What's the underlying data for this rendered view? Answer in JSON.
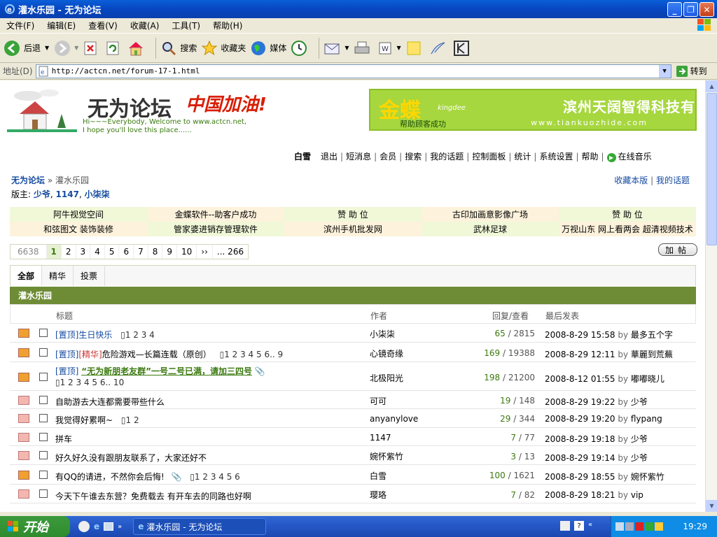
{
  "window": {
    "title": "灌水乐园 - 无为论坛"
  },
  "menu": [
    "文件(F)",
    "编辑(E)",
    "查看(V)",
    "收藏(A)",
    "工具(T)",
    "帮助(H)"
  ],
  "toolbar": {
    "back": "后退",
    "search": "搜索",
    "favorites": "收藏夹",
    "media": "媒体"
  },
  "address": {
    "label": "地址(D)",
    "url": "http://actcn.net/forum-17-1.html",
    "go": "转到"
  },
  "header": {
    "logo_title": "无为论坛",
    "logo_slogan": "中国加油!",
    "logo_greet1": "Hi~~~Everybody, Welcome to www.actcn.net,",
    "logo_greet2": "I hope you'll love this place......",
    "banner_brand": "金蝶",
    "banner_brand_en": "kingdee",
    "banner_slogan": "帮助顾客成功",
    "banner_company": "滨州天阔智得科技有",
    "banner_url": "www.tiankuozhide.com"
  },
  "nav": {
    "user": "白雪",
    "items": [
      "退出",
      "短消息",
      "会员",
      "搜索",
      "我的话题",
      "控制面板",
      "统计",
      "系统设置",
      "帮助"
    ],
    "music": "在线音乐"
  },
  "breadcrumb": {
    "home": "无为论坛",
    "current": "» 灌水乐园"
  },
  "moderators": {
    "label": "版主:",
    "names": [
      "少爷",
      "1147",
      "小柒柒"
    ]
  },
  "right_links": [
    "收藏本版",
    "我的话题"
  ],
  "ads": [
    "阿牛视觉空间",
    "金蝶软件--助客户成功",
    "赞 助 位",
    "古印加画意影像广场",
    "赞 助 位",
    "和弦图文 装饰装修",
    "管家婆进销存管理软件",
    "滨州手机批发网",
    "武林足球",
    "万视山东 网上看两会 超清视频技术"
  ],
  "pager": {
    "total": "6638",
    "pages": [
      "1",
      "2",
      "3",
      "4",
      "5",
      "6",
      "7",
      "8",
      "9",
      "10"
    ],
    "next": "››",
    "last": "... 266"
  },
  "post_button": "加帖",
  "tabs": [
    "全部",
    "精华",
    "投票"
  ],
  "forum_name": "灌水乐园",
  "columns": {
    "title": "标题",
    "author": "作者",
    "stats": "回复/查看",
    "last": "最后发表"
  },
  "threads": [
    {
      "tag": "[置顶]",
      "title": "生日快乐",
      "pages": "1 2 3 4",
      "author": "小柒柒",
      "replies": "65",
      "views": "2815",
      "last_time": "2008-8-29 15:58",
      "last_by": "最多五个字"
    },
    {
      "tag": "[置顶]",
      "tag2": "[精华]",
      "title": "危险游戏—长篇连载（原创）",
      "pages": "1 2 3 4 5 6.. 9",
      "author": "心镜奇缘",
      "replies": "169",
      "views": "19388",
      "last_time": "2008-8-29 12:11",
      "last_by": "華麗到荒蕪"
    },
    {
      "tag": "[置顶]",
      "hot": "“无为新朋老友群”一号二号已满，请加三四号",
      "pages": "1 2 3 4 5 6.. 10",
      "author": "北极阳光",
      "replies": "198",
      "views": "21200",
      "last_time": "2008-8-12 01:55",
      "last_by": "嘟嘟晓儿"
    },
    {
      "title": "自助游去大连都需要带些什么",
      "author": "可可",
      "replies": "19",
      "views": "148",
      "last_time": "2008-8-29 19:22",
      "last_by": "少爷"
    },
    {
      "title": "我觉得好累啊~",
      "pages": "1 2",
      "author": "anyanylove",
      "replies": "29",
      "views": "344",
      "last_time": "2008-8-29 19:20",
      "last_by": "flypang"
    },
    {
      "title": "拼车",
      "author": "1147",
      "replies": "7",
      "views": "77",
      "last_time": "2008-8-29 19:18",
      "last_by": "少爷"
    },
    {
      "title": "好久好久没有跟朋友联系了，大家还好不",
      "author": "婉怀紫竹",
      "replies": "3",
      "views": "13",
      "last_time": "2008-8-29 19:14",
      "last_by": "少爷"
    },
    {
      "title": "有QQ的请进，不然你会后悔!",
      "pages": "1 2 3 4 5 6",
      "author": "白雪",
      "replies": "100",
      "views": "1621",
      "last_time": "2008-8-29 18:55",
      "last_by": "婉怀紫竹"
    },
    {
      "title": "今天下午谁去东营？免费载去 有开车去的同路也好啊",
      "author": "璎珞",
      "replies": "7",
      "views": "82",
      "last_time": "2008-8-29 18:21",
      "last_by": "vip"
    }
  ],
  "taskbar": {
    "start": "开始",
    "task": "灌水乐园 - 无为论坛",
    "clock": "19:29"
  },
  "by": "by"
}
